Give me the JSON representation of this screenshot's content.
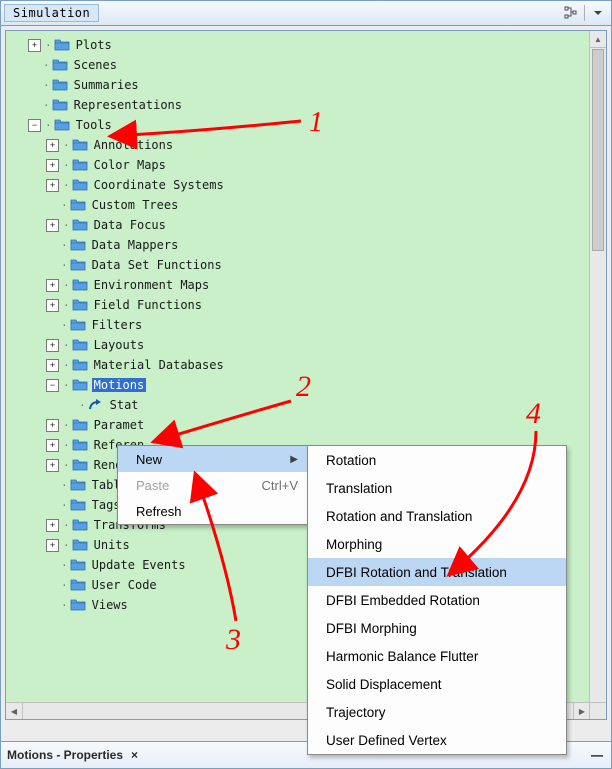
{
  "title": "Simulation",
  "tree": {
    "root_items": [
      {
        "label": "Plots",
        "twisty": "plus",
        "depth": 1
      },
      {
        "label": "Scenes",
        "twisty": "none",
        "depth": 1
      },
      {
        "label": "Summaries",
        "twisty": "none",
        "depth": 1
      },
      {
        "label": "Representations",
        "twisty": "none",
        "depth": 1
      },
      {
        "label": "Tools",
        "twisty": "minus",
        "depth": 1
      }
    ],
    "tools_children": [
      {
        "label": "Annotations",
        "twisty": "plus"
      },
      {
        "label": "Color Maps",
        "twisty": "plus"
      },
      {
        "label": "Coordinate Systems",
        "twisty": "plus"
      },
      {
        "label": "Custom Trees",
        "twisty": "none"
      },
      {
        "label": "Data Focus",
        "twisty": "plus"
      },
      {
        "label": "Data Mappers",
        "twisty": "none"
      },
      {
        "label": "Data Set Functions",
        "twisty": "none"
      },
      {
        "label": "Environment Maps",
        "twisty": "plus"
      },
      {
        "label": "Field Functions",
        "twisty": "plus"
      },
      {
        "label": "Filters",
        "twisty": "none"
      },
      {
        "label": "Layouts",
        "twisty": "plus"
      },
      {
        "label": "Material Databases",
        "twisty": "plus"
      },
      {
        "label": "Motions",
        "twisty": "minus",
        "selected": true
      },
      {
        "label": "Stat",
        "twisty": "none",
        "icon": "arrow",
        "depth": 3,
        "cut": true
      },
      {
        "label": "Paramet",
        "twisty": "plus",
        "cut": true
      },
      {
        "label": "Referen",
        "twisty": "plus",
        "cut": true
      },
      {
        "label": "Renderi",
        "twisty": "plus",
        "cut": true
      },
      {
        "label": "Tables",
        "twisty": "none"
      },
      {
        "label": "Tags",
        "twisty": "none"
      },
      {
        "label": "Transforms",
        "twisty": "plus"
      },
      {
        "label": "Units",
        "twisty": "plus"
      },
      {
        "label": "Update Events",
        "twisty": "none"
      },
      {
        "label": "User Code",
        "twisty": "none"
      },
      {
        "label": "Views",
        "twisty": "none"
      }
    ]
  },
  "ctx1": {
    "items": [
      {
        "label": "New",
        "highlight": true,
        "submenu": true
      },
      {
        "label": "Paste",
        "accel": "Ctrl+V",
        "disabled": true
      },
      {
        "label": "Refresh"
      }
    ]
  },
  "ctx2": {
    "items": [
      {
        "label": "Rotation"
      },
      {
        "label": "Translation"
      },
      {
        "label": "Rotation and Translation"
      },
      {
        "label": "Morphing"
      },
      {
        "label": "DFBI Rotation and Translation",
        "highlight": true
      },
      {
        "label": "DFBI Embedded Rotation"
      },
      {
        "label": "DFBI Morphing"
      },
      {
        "label": "Harmonic Balance Flutter"
      },
      {
        "label": "Solid Displacement"
      },
      {
        "label": "Trajectory"
      },
      {
        "label": "User Defined Vertex"
      }
    ]
  },
  "properties_tab": "Motions - Properties",
  "annotations": {
    "n1": "1",
    "n2": "2",
    "n3": "3",
    "n4": "4"
  },
  "colors": {
    "tree_bg": "#c9f0c9",
    "selection": "#2f6fd0",
    "menu_hl": "#bcd7f4",
    "anno": "#ff0000"
  }
}
